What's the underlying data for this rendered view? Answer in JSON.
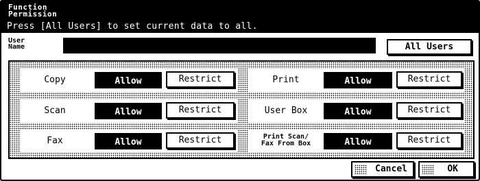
{
  "header": {
    "title": "Function\nPermission",
    "message": "Press [All Users] to set current data to all."
  },
  "user": {
    "label": "User\nName",
    "value": ""
  },
  "buttons": {
    "all_users": "All Users",
    "cancel": "Cancel",
    "ok": "OK"
  },
  "functions": [
    {
      "label": "Copy",
      "allow": "Allow",
      "restrict": "Restrict",
      "selected": "Allow"
    },
    {
      "label": "Scan",
      "allow": "Allow",
      "restrict": "Restrict",
      "selected": "Allow"
    },
    {
      "label": "Fax",
      "allow": "Allow",
      "restrict": "Restrict",
      "selected": "Allow"
    },
    {
      "label": "Print",
      "allow": "Allow",
      "restrict": "Restrict",
      "selected": "Allow"
    },
    {
      "label": "User Box",
      "allow": "Allow",
      "restrict": "Restrict",
      "selected": "Allow"
    },
    {
      "label": "Print Scan/\nFax From Box",
      "allow": "Allow",
      "restrict": "Restrict",
      "selected": "Allow"
    }
  ]
}
